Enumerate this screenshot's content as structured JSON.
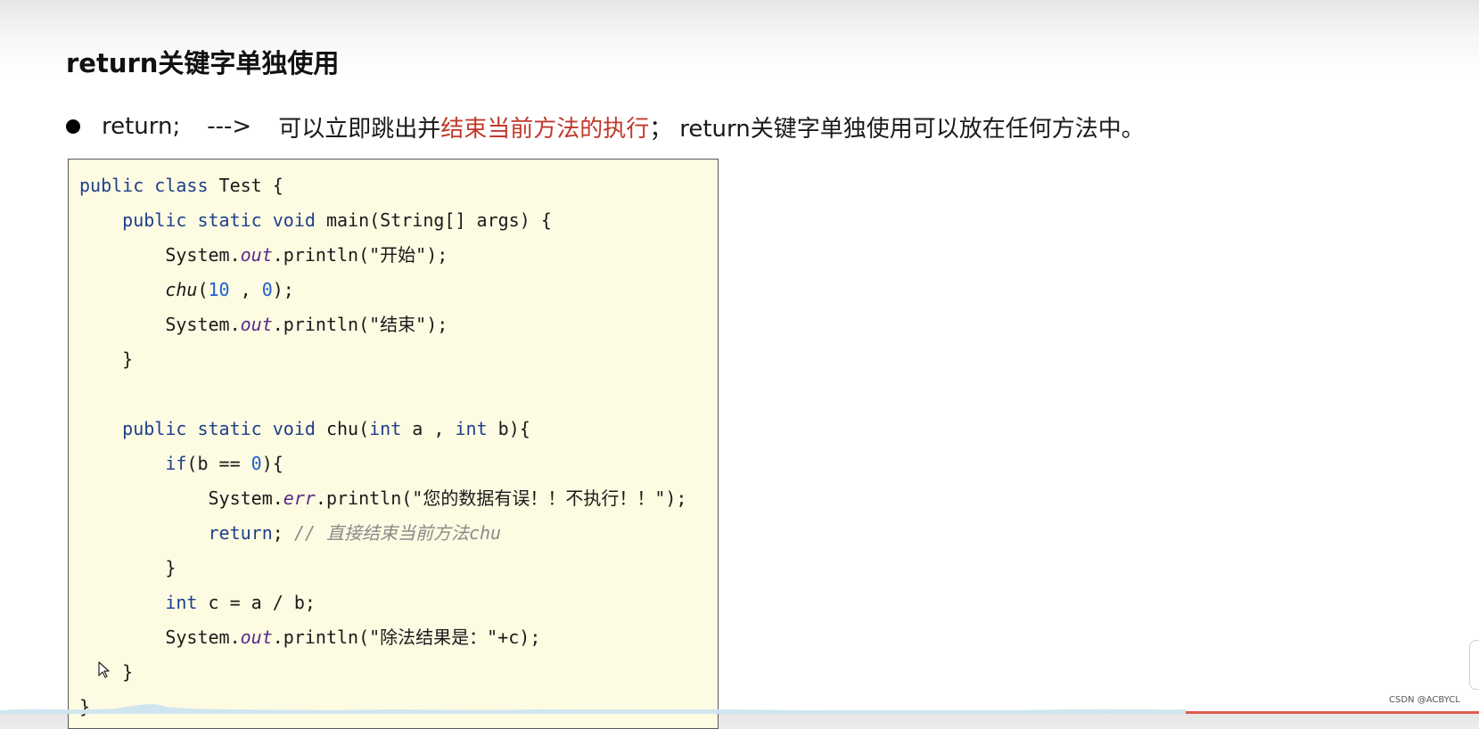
{
  "title": "return关键字单独使用",
  "bullet": {
    "part1": "return;",
    "part2": "--->",
    "part3": "可以立即跳出并",
    "highlight": "结束当前方法的执行",
    "part4": "；",
    "part5": "return关键字单独使用可以放在任何方法中。"
  },
  "code": {
    "l1_kw": "public class",
    "l1_rest": " Test {",
    "l2_kw": "public static void",
    "l2_rest": " main(String[] args) {",
    "l3_a": "System.",
    "l3_b": "out",
    "l3_c": ".println(\"开始\");",
    "l4_fn": "chu",
    "l4_a": "(",
    "l4_n1": "10",
    "l4_b": " , ",
    "l4_n2": "0",
    "l4_c": ");",
    "l5_a": "System.",
    "l5_b": "out",
    "l5_c": ".println(\"结束\");",
    "l6": "}",
    "l8_kw": "public static void",
    "l8_a": " chu(",
    "l8_kw2": "int",
    "l8_b": " a , ",
    "l8_kw3": "int",
    "l8_c": " b){",
    "l9_kw": "if",
    "l9_a": "(b == ",
    "l9_n": "0",
    "l9_b": "){",
    "l10_a": "System.",
    "l10_b": "err",
    "l10_c": ".println(\"您的数据有误！！不执行！！\");",
    "l11_kw": "return",
    "l11_a": "; ",
    "l11_cm": "// 直接结束当前方法chu",
    "l12": "}",
    "l13_kw": "int",
    "l13_a": " c = a / b;",
    "l14_a": "System.",
    "l14_b": "out",
    "l14_c": ".println(\"除法结果是：\"+c);",
    "l15": "}",
    "l16": "}"
  },
  "watermark": "CSDN @ACBYCL",
  "colors": {
    "highlight": "#c0392b",
    "keyword": "#1f3f8c",
    "code_background": "#fdfbe2"
  },
  "icons": [
    "mouse-pointer-icon"
  ]
}
